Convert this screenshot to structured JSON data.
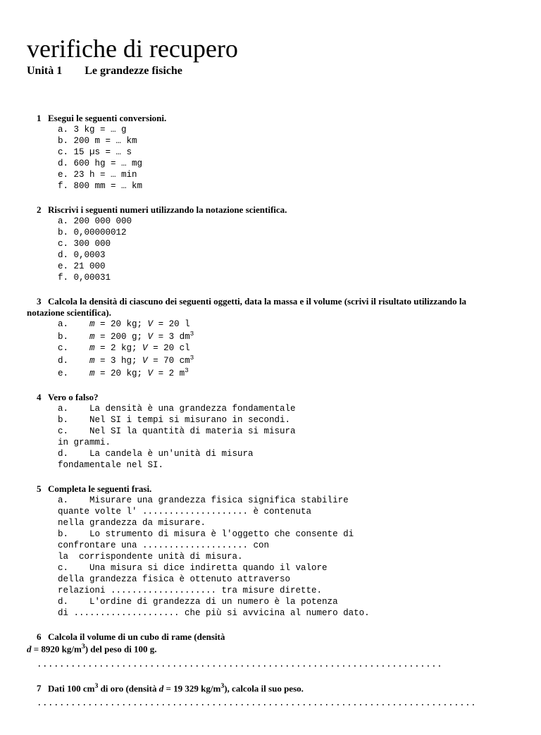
{
  "title": "verifiche di recupero",
  "unit_label": "Unità 1",
  "unit_title": "Le grandezze fisiche",
  "questions": {
    "q1": {
      "num": "1",
      "prompt": "Esegui le seguenti conversioni.",
      "body": "a. 3 kg = … g\nb. 200 m = … km\nc. 15 µs = … s\nd. 600 hg = … mg\ne. 23 h = … min\nf. 800 mm = … km"
    },
    "q2": {
      "num": "2",
      "prompt": "Riscrivi i seguenti numeri utilizzando la notazione scientifica.",
      "body": "a. 200 000 000\nb. 0,00000012\nc. 300 000\nd. 0,0003\ne. 21 000\nf. 0,00031"
    },
    "q3": {
      "num": "3",
      "prompt_a": "Calcola la densità di ciascuno dei seguenti oggetti, data la massa e il volume (scrivi il risultato utilizzando la",
      "prompt_b": "notazione scientifica)."
    },
    "q4": {
      "num": "4",
      "prompt": "Vero o falso?",
      "body": "a.    La densità è una grandezza fondamentale\nb.    Nel SI i tempi si misurano in secondi.\nc.    Nel SI la quantità di materia si misura\nin grammi.\nd.    La candela è un'unità di misura\nfondamentale nel SI."
    },
    "q5": {
      "num": "5",
      "prompt": "Completa le seguenti frasi.",
      "body": "a.    Misurare una grandezza fisica significa stabilire\nquante volte l' .................... è contenuta\nnella grandezza da misurare.\nb.    Lo strumento di misura è l'oggetto che consente di\nconfrontare una .................... con\nla  corrispondente unità di misura.\nc.    Una misura si dice indiretta quando il valore\ndella grandezza fisica è ottenuto attraverso\nrelazioni .................... tra misure dirette.\nd.    L'ordine di grandezza di un numero è la potenza\ndi .................... che più si avvicina al numero dato."
    },
    "q6": {
      "num": "6",
      "dots": "........................................................................"
    },
    "q7": {
      "num": "7",
      "dots": ".............................................................................."
    }
  }
}
